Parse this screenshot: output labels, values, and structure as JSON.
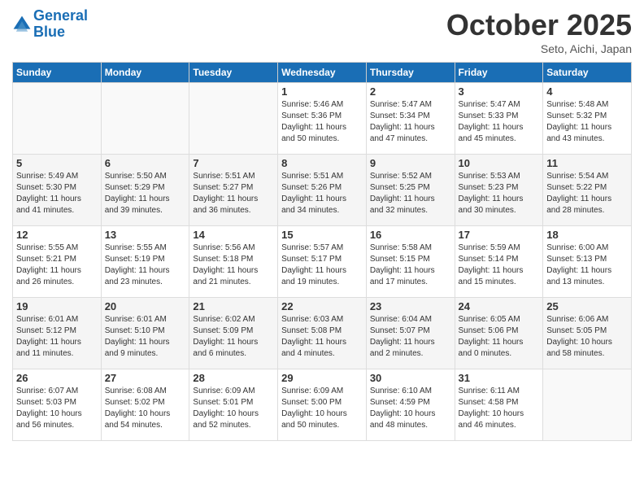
{
  "header": {
    "logo_line1": "General",
    "logo_line2": "Blue",
    "month": "October 2025",
    "location": "Seto, Aichi, Japan"
  },
  "weekdays": [
    "Sunday",
    "Monday",
    "Tuesday",
    "Wednesday",
    "Thursday",
    "Friday",
    "Saturday"
  ],
  "weeks": [
    [
      {
        "day": "",
        "info": ""
      },
      {
        "day": "",
        "info": ""
      },
      {
        "day": "",
        "info": ""
      },
      {
        "day": "1",
        "info": "Sunrise: 5:46 AM\nSunset: 5:36 PM\nDaylight: 11 hours\nand 50 minutes."
      },
      {
        "day": "2",
        "info": "Sunrise: 5:47 AM\nSunset: 5:34 PM\nDaylight: 11 hours\nand 47 minutes."
      },
      {
        "day": "3",
        "info": "Sunrise: 5:47 AM\nSunset: 5:33 PM\nDaylight: 11 hours\nand 45 minutes."
      },
      {
        "day": "4",
        "info": "Sunrise: 5:48 AM\nSunset: 5:32 PM\nDaylight: 11 hours\nand 43 minutes."
      }
    ],
    [
      {
        "day": "5",
        "info": "Sunrise: 5:49 AM\nSunset: 5:30 PM\nDaylight: 11 hours\nand 41 minutes."
      },
      {
        "day": "6",
        "info": "Sunrise: 5:50 AM\nSunset: 5:29 PM\nDaylight: 11 hours\nand 39 minutes."
      },
      {
        "day": "7",
        "info": "Sunrise: 5:51 AM\nSunset: 5:27 PM\nDaylight: 11 hours\nand 36 minutes."
      },
      {
        "day": "8",
        "info": "Sunrise: 5:51 AM\nSunset: 5:26 PM\nDaylight: 11 hours\nand 34 minutes."
      },
      {
        "day": "9",
        "info": "Sunrise: 5:52 AM\nSunset: 5:25 PM\nDaylight: 11 hours\nand 32 minutes."
      },
      {
        "day": "10",
        "info": "Sunrise: 5:53 AM\nSunset: 5:23 PM\nDaylight: 11 hours\nand 30 minutes."
      },
      {
        "day": "11",
        "info": "Sunrise: 5:54 AM\nSunset: 5:22 PM\nDaylight: 11 hours\nand 28 minutes."
      }
    ],
    [
      {
        "day": "12",
        "info": "Sunrise: 5:55 AM\nSunset: 5:21 PM\nDaylight: 11 hours\nand 26 minutes."
      },
      {
        "day": "13",
        "info": "Sunrise: 5:55 AM\nSunset: 5:19 PM\nDaylight: 11 hours\nand 23 minutes."
      },
      {
        "day": "14",
        "info": "Sunrise: 5:56 AM\nSunset: 5:18 PM\nDaylight: 11 hours\nand 21 minutes."
      },
      {
        "day": "15",
        "info": "Sunrise: 5:57 AM\nSunset: 5:17 PM\nDaylight: 11 hours\nand 19 minutes."
      },
      {
        "day": "16",
        "info": "Sunrise: 5:58 AM\nSunset: 5:15 PM\nDaylight: 11 hours\nand 17 minutes."
      },
      {
        "day": "17",
        "info": "Sunrise: 5:59 AM\nSunset: 5:14 PM\nDaylight: 11 hours\nand 15 minutes."
      },
      {
        "day": "18",
        "info": "Sunrise: 6:00 AM\nSunset: 5:13 PM\nDaylight: 11 hours\nand 13 minutes."
      }
    ],
    [
      {
        "day": "19",
        "info": "Sunrise: 6:01 AM\nSunset: 5:12 PM\nDaylight: 11 hours\nand 11 minutes."
      },
      {
        "day": "20",
        "info": "Sunrise: 6:01 AM\nSunset: 5:10 PM\nDaylight: 11 hours\nand 9 minutes."
      },
      {
        "day": "21",
        "info": "Sunrise: 6:02 AM\nSunset: 5:09 PM\nDaylight: 11 hours\nand 6 minutes."
      },
      {
        "day": "22",
        "info": "Sunrise: 6:03 AM\nSunset: 5:08 PM\nDaylight: 11 hours\nand 4 minutes."
      },
      {
        "day": "23",
        "info": "Sunrise: 6:04 AM\nSunset: 5:07 PM\nDaylight: 11 hours\nand 2 minutes."
      },
      {
        "day": "24",
        "info": "Sunrise: 6:05 AM\nSunset: 5:06 PM\nDaylight: 11 hours\nand 0 minutes."
      },
      {
        "day": "25",
        "info": "Sunrise: 6:06 AM\nSunset: 5:05 PM\nDaylight: 10 hours\nand 58 minutes."
      }
    ],
    [
      {
        "day": "26",
        "info": "Sunrise: 6:07 AM\nSunset: 5:03 PM\nDaylight: 10 hours\nand 56 minutes."
      },
      {
        "day": "27",
        "info": "Sunrise: 6:08 AM\nSunset: 5:02 PM\nDaylight: 10 hours\nand 54 minutes."
      },
      {
        "day": "28",
        "info": "Sunrise: 6:09 AM\nSunset: 5:01 PM\nDaylight: 10 hours\nand 52 minutes."
      },
      {
        "day": "29",
        "info": "Sunrise: 6:09 AM\nSunset: 5:00 PM\nDaylight: 10 hours\nand 50 minutes."
      },
      {
        "day": "30",
        "info": "Sunrise: 6:10 AM\nSunset: 4:59 PM\nDaylight: 10 hours\nand 48 minutes."
      },
      {
        "day": "31",
        "info": "Sunrise: 6:11 AM\nSunset: 4:58 PM\nDaylight: 10 hours\nand 46 minutes."
      },
      {
        "day": "",
        "info": ""
      }
    ]
  ]
}
